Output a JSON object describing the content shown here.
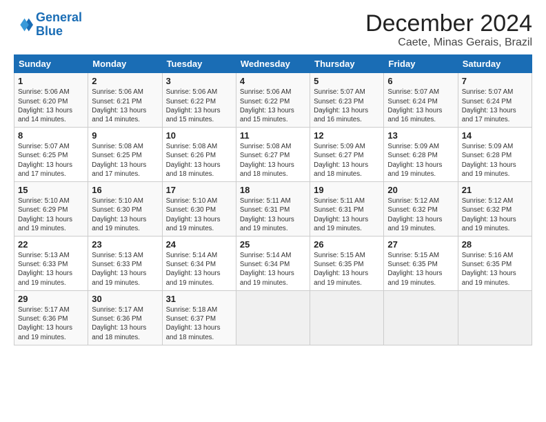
{
  "logo": {
    "line1": "General",
    "line2": "Blue"
  },
  "title": "December 2024",
  "location": "Caete, Minas Gerais, Brazil",
  "weekdays": [
    "Sunday",
    "Monday",
    "Tuesday",
    "Wednesday",
    "Thursday",
    "Friday",
    "Saturday"
  ],
  "weeks": [
    [
      {
        "day": "1",
        "info": "Sunrise: 5:06 AM\nSunset: 6:20 PM\nDaylight: 13 hours\nand 14 minutes."
      },
      {
        "day": "2",
        "info": "Sunrise: 5:06 AM\nSunset: 6:21 PM\nDaylight: 13 hours\nand 14 minutes."
      },
      {
        "day": "3",
        "info": "Sunrise: 5:06 AM\nSunset: 6:22 PM\nDaylight: 13 hours\nand 15 minutes."
      },
      {
        "day": "4",
        "info": "Sunrise: 5:06 AM\nSunset: 6:22 PM\nDaylight: 13 hours\nand 15 minutes."
      },
      {
        "day": "5",
        "info": "Sunrise: 5:07 AM\nSunset: 6:23 PM\nDaylight: 13 hours\nand 16 minutes."
      },
      {
        "day": "6",
        "info": "Sunrise: 5:07 AM\nSunset: 6:24 PM\nDaylight: 13 hours\nand 16 minutes."
      },
      {
        "day": "7",
        "info": "Sunrise: 5:07 AM\nSunset: 6:24 PM\nDaylight: 13 hours\nand 17 minutes."
      }
    ],
    [
      {
        "day": "8",
        "info": "Sunrise: 5:07 AM\nSunset: 6:25 PM\nDaylight: 13 hours\nand 17 minutes."
      },
      {
        "day": "9",
        "info": "Sunrise: 5:08 AM\nSunset: 6:25 PM\nDaylight: 13 hours\nand 17 minutes."
      },
      {
        "day": "10",
        "info": "Sunrise: 5:08 AM\nSunset: 6:26 PM\nDaylight: 13 hours\nand 18 minutes."
      },
      {
        "day": "11",
        "info": "Sunrise: 5:08 AM\nSunset: 6:27 PM\nDaylight: 13 hours\nand 18 minutes."
      },
      {
        "day": "12",
        "info": "Sunrise: 5:09 AM\nSunset: 6:27 PM\nDaylight: 13 hours\nand 18 minutes."
      },
      {
        "day": "13",
        "info": "Sunrise: 5:09 AM\nSunset: 6:28 PM\nDaylight: 13 hours\nand 19 minutes."
      },
      {
        "day": "14",
        "info": "Sunrise: 5:09 AM\nSunset: 6:28 PM\nDaylight: 13 hours\nand 19 minutes."
      }
    ],
    [
      {
        "day": "15",
        "info": "Sunrise: 5:10 AM\nSunset: 6:29 PM\nDaylight: 13 hours\nand 19 minutes."
      },
      {
        "day": "16",
        "info": "Sunrise: 5:10 AM\nSunset: 6:30 PM\nDaylight: 13 hours\nand 19 minutes."
      },
      {
        "day": "17",
        "info": "Sunrise: 5:10 AM\nSunset: 6:30 PM\nDaylight: 13 hours\nand 19 minutes."
      },
      {
        "day": "18",
        "info": "Sunrise: 5:11 AM\nSunset: 6:31 PM\nDaylight: 13 hours\nand 19 minutes."
      },
      {
        "day": "19",
        "info": "Sunrise: 5:11 AM\nSunset: 6:31 PM\nDaylight: 13 hours\nand 19 minutes."
      },
      {
        "day": "20",
        "info": "Sunrise: 5:12 AM\nSunset: 6:32 PM\nDaylight: 13 hours\nand 19 minutes."
      },
      {
        "day": "21",
        "info": "Sunrise: 5:12 AM\nSunset: 6:32 PM\nDaylight: 13 hours\nand 19 minutes."
      }
    ],
    [
      {
        "day": "22",
        "info": "Sunrise: 5:13 AM\nSunset: 6:33 PM\nDaylight: 13 hours\nand 19 minutes."
      },
      {
        "day": "23",
        "info": "Sunrise: 5:13 AM\nSunset: 6:33 PM\nDaylight: 13 hours\nand 19 minutes."
      },
      {
        "day": "24",
        "info": "Sunrise: 5:14 AM\nSunset: 6:34 PM\nDaylight: 13 hours\nand 19 minutes."
      },
      {
        "day": "25",
        "info": "Sunrise: 5:14 AM\nSunset: 6:34 PM\nDaylight: 13 hours\nand 19 minutes."
      },
      {
        "day": "26",
        "info": "Sunrise: 5:15 AM\nSunset: 6:35 PM\nDaylight: 13 hours\nand 19 minutes."
      },
      {
        "day": "27",
        "info": "Sunrise: 5:15 AM\nSunset: 6:35 PM\nDaylight: 13 hours\nand 19 minutes."
      },
      {
        "day": "28",
        "info": "Sunrise: 5:16 AM\nSunset: 6:35 PM\nDaylight: 13 hours\nand 19 minutes."
      }
    ],
    [
      {
        "day": "29",
        "info": "Sunrise: 5:17 AM\nSunset: 6:36 PM\nDaylight: 13 hours\nand 19 minutes."
      },
      {
        "day": "30",
        "info": "Sunrise: 5:17 AM\nSunset: 6:36 PM\nDaylight: 13 hours\nand 18 minutes."
      },
      {
        "day": "31",
        "info": "Sunrise: 5:18 AM\nSunset: 6:37 PM\nDaylight: 13 hours\nand 18 minutes."
      },
      {
        "day": "",
        "info": ""
      },
      {
        "day": "",
        "info": ""
      },
      {
        "day": "",
        "info": ""
      },
      {
        "day": "",
        "info": ""
      }
    ]
  ]
}
